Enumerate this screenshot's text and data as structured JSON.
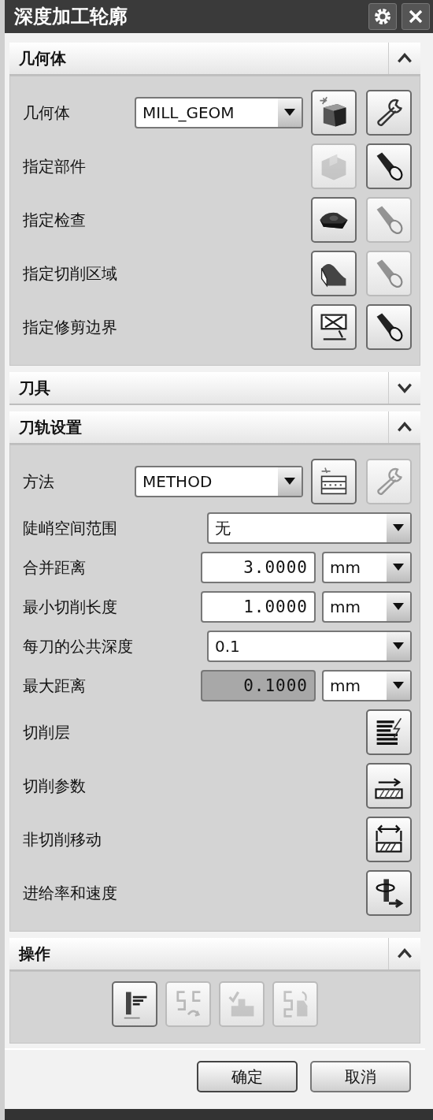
{
  "window": {
    "title": "深度加工轮廓"
  },
  "sections": [
    {
      "title": "几何体",
      "expanded": true,
      "rows": [
        {
          "kind": "select_tools",
          "label": "几何体",
          "value": "MILL_GEOM",
          "buttons": [
            {
              "disabled": false
            },
            {
              "disabled": false
            }
          ]
        },
        {
          "kind": "tools",
          "label": "指定部件",
          "buttons": [
            {
              "disabled": true
            },
            {
              "disabled": false
            }
          ]
        },
        {
          "kind": "tools",
          "label": "指定检查",
          "buttons": [
            {
              "disabled": false
            },
            {
              "disabled": true
            }
          ]
        },
        {
          "kind": "tools",
          "label": "指定切削区域",
          "buttons": [
            {
              "disabled": false
            },
            {
              "disabled": true
            }
          ]
        },
        {
          "kind": "tools",
          "label": "指定修剪边界",
          "buttons": [
            {
              "disabled": false
            },
            {
              "disabled": false
            }
          ]
        }
      ]
    },
    {
      "title": "刀具",
      "expanded": false
    },
    {
      "title": "刀轨设置",
      "expanded": true,
      "rows": [
        {
          "kind": "select_tools",
          "label": "方法",
          "value": "METHOD",
          "buttons": [
            {
              "disabled": false
            },
            {
              "disabled": true
            }
          ]
        },
        {
          "kind": "select",
          "label": "陡峭空间范围",
          "value": "无"
        },
        {
          "kind": "measure",
          "label": "合并距离",
          "value": "3.0000",
          "unit": "mm",
          "disabled": false
        },
        {
          "kind": "measure",
          "label": "最小切削长度",
          "value": "1.0000",
          "unit": "mm",
          "disabled": false
        },
        {
          "kind": "select",
          "label": "每刀的公共深度",
          "value": "0.1"
        },
        {
          "kind": "measure",
          "label": "最大距离",
          "value": "0.1000",
          "unit": "mm",
          "disabled": true
        },
        {
          "kind": "tools",
          "label": "切削层",
          "buttons": [
            {
              "disabled": false
            }
          ]
        },
        {
          "kind": "tools",
          "label": "切削参数",
          "buttons": [
            {
              "disabled": false
            }
          ]
        },
        {
          "kind": "tools",
          "label": "非切削移动",
          "buttons": [
            {
              "disabled": false
            }
          ]
        },
        {
          "kind": "tools",
          "label": "进给率和速度",
          "buttons": [
            {
              "disabled": false
            }
          ]
        }
      ]
    },
    {
      "title": "操作",
      "expanded": true,
      "actions": [
        {
          "disabled": false
        },
        {
          "disabled": true
        },
        {
          "disabled": true
        },
        {
          "disabled": true
        }
      ]
    }
  ],
  "footer_buttons": [
    {
      "label": "确定"
    },
    {
      "label": "取消"
    }
  ]
}
